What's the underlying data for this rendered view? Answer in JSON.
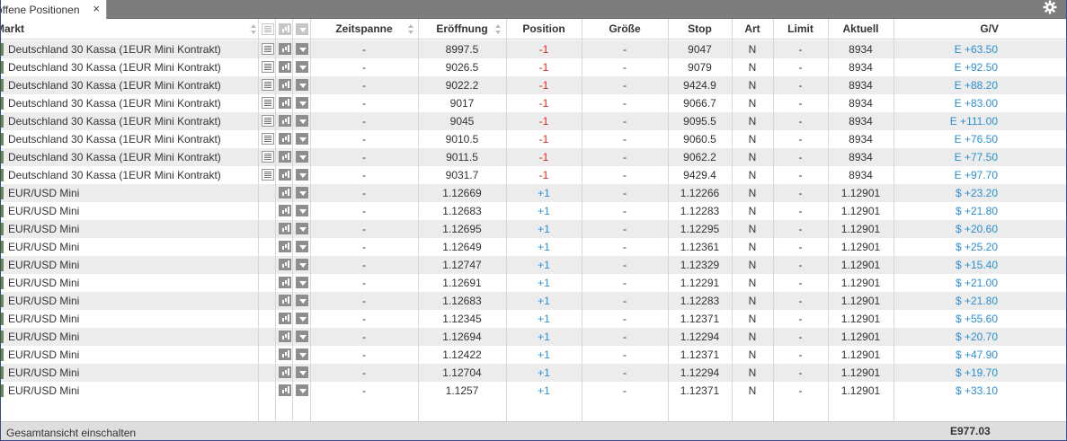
{
  "tab": {
    "label": "offene Positionen",
    "close": "×"
  },
  "header": {
    "market": "Markt",
    "zeitspanne": "Zeitspanne",
    "eroeffnung": "Eröffnung",
    "position": "Position",
    "groesse": "Größe",
    "stop": "Stop",
    "art": "Art",
    "limit": "Limit",
    "aktuell": "Aktuell",
    "gv": "G/V"
  },
  "rows": [
    {
      "market": "Deutschland 30 Kassa (1EUR Mini Kontrakt)",
      "has_doc": true,
      "zeitspanne": "-",
      "open": "8997.5",
      "position": "-1",
      "size": "-",
      "stop": "9047",
      "art": "N",
      "limit": "-",
      "current": "8934",
      "gv": "E +63.50"
    },
    {
      "market": "Deutschland 30 Kassa (1EUR Mini Kontrakt)",
      "has_doc": true,
      "zeitspanne": "-",
      "open": "9026.5",
      "position": "-1",
      "size": "-",
      "stop": "9079",
      "art": "N",
      "limit": "-",
      "current": "8934",
      "gv": "E +92.50"
    },
    {
      "market": "Deutschland 30 Kassa (1EUR Mini Kontrakt)",
      "has_doc": true,
      "zeitspanne": "-",
      "open": "9022.2",
      "position": "-1",
      "size": "-",
      "stop": "9424.9",
      "art": "N",
      "limit": "-",
      "current": "8934",
      "gv": "E +88.20"
    },
    {
      "market": "Deutschland 30 Kassa (1EUR Mini Kontrakt)",
      "has_doc": true,
      "zeitspanne": "-",
      "open": "9017",
      "position": "-1",
      "size": "-",
      "stop": "9066.7",
      "art": "N",
      "limit": "-",
      "current": "8934",
      "gv": "E +83.00"
    },
    {
      "market": "Deutschland 30 Kassa (1EUR Mini Kontrakt)",
      "has_doc": true,
      "zeitspanne": "-",
      "open": "9045",
      "position": "-1",
      "size": "-",
      "stop": "9095.5",
      "art": "N",
      "limit": "-",
      "current": "8934",
      "gv": "E +111.00"
    },
    {
      "market": "Deutschland 30 Kassa (1EUR Mini Kontrakt)",
      "has_doc": true,
      "zeitspanne": "-",
      "open": "9010.5",
      "position": "-1",
      "size": "-",
      "stop": "9060.5",
      "art": "N",
      "limit": "-",
      "current": "8934",
      "gv": "E +76.50"
    },
    {
      "market": "Deutschland 30 Kassa (1EUR Mini Kontrakt)",
      "has_doc": true,
      "zeitspanne": "-",
      "open": "9011.5",
      "position": "-1",
      "size": "-",
      "stop": "9062.2",
      "art": "N",
      "limit": "-",
      "current": "8934",
      "gv": "E +77.50"
    },
    {
      "market": "Deutschland 30 Kassa (1EUR Mini Kontrakt)",
      "has_doc": true,
      "zeitspanne": "-",
      "open": "9031.7",
      "position": "-1",
      "size": "-",
      "stop": "9429.4",
      "art": "N",
      "limit": "-",
      "current": "8934",
      "gv": "E +97.70"
    },
    {
      "market": "EUR/USD Mini",
      "has_doc": false,
      "zeitspanne": "-",
      "open": "1.12669",
      "position": "+1",
      "size": "-",
      "stop": "1.12266",
      "art": "N",
      "limit": "-",
      "current": "1.12901",
      "gv": "$ +23.20"
    },
    {
      "market": "EUR/USD Mini",
      "has_doc": false,
      "zeitspanne": "-",
      "open": "1.12683",
      "position": "+1",
      "size": "-",
      "stop": "1.12283",
      "art": "N",
      "limit": "-",
      "current": "1.12901",
      "gv": "$ +21.80"
    },
    {
      "market": "EUR/USD Mini",
      "has_doc": false,
      "zeitspanne": "-",
      "open": "1.12695",
      "position": "+1",
      "size": "-",
      "stop": "1.12295",
      "art": "N",
      "limit": "-",
      "current": "1.12901",
      "gv": "$ +20.60"
    },
    {
      "market": "EUR/USD Mini",
      "has_doc": false,
      "zeitspanne": "-",
      "open": "1.12649",
      "position": "+1",
      "size": "-",
      "stop": "1.12361",
      "art": "N",
      "limit": "-",
      "current": "1.12901",
      "gv": "$ +25.20"
    },
    {
      "market": "EUR/USD Mini",
      "has_doc": false,
      "zeitspanne": "-",
      "open": "1.12747",
      "position": "+1",
      "size": "-",
      "stop": "1.12329",
      "art": "N",
      "limit": "-",
      "current": "1.12901",
      "gv": "$ +15.40"
    },
    {
      "market": "EUR/USD Mini",
      "has_doc": false,
      "zeitspanne": "-",
      "open": "1.12691",
      "position": "+1",
      "size": "-",
      "stop": "1.12291",
      "art": "N",
      "limit": "-",
      "current": "1.12901",
      "gv": "$ +21.00"
    },
    {
      "market": "EUR/USD Mini",
      "has_doc": false,
      "zeitspanne": "-",
      "open": "1.12683",
      "position": "+1",
      "size": "-",
      "stop": "1.12283",
      "art": "N",
      "limit": "-",
      "current": "1.12901",
      "gv": "$ +21.80"
    },
    {
      "market": "EUR/USD Mini",
      "has_doc": false,
      "zeitspanne": "-",
      "open": "1.12345",
      "position": "+1",
      "size": "-",
      "stop": "1.12371",
      "art": "N",
      "limit": "-",
      "current": "1.12901",
      "gv": "$ +55.60"
    },
    {
      "market": "EUR/USD Mini",
      "has_doc": false,
      "zeitspanne": "-",
      "open": "1.12694",
      "position": "+1",
      "size": "-",
      "stop": "1.12294",
      "art": "N",
      "limit": "-",
      "current": "1.12901",
      "gv": "$ +20.70"
    },
    {
      "market": "EUR/USD Mini",
      "has_doc": false,
      "zeitspanne": "-",
      "open": "1.12422",
      "position": "+1",
      "size": "-",
      "stop": "1.12371",
      "art": "N",
      "limit": "-",
      "current": "1.12901",
      "gv": "$ +47.90"
    },
    {
      "market": "EUR/USD Mini",
      "has_doc": false,
      "zeitspanne": "-",
      "open": "1.12704",
      "position": "+1",
      "size": "-",
      "stop": "1.12294",
      "art": "N",
      "limit": "-",
      "current": "1.12901",
      "gv": "$ +19.70"
    },
    {
      "market": "EUR/USD Mini",
      "has_doc": false,
      "zeitspanne": "-",
      "open": "1.1257",
      "position": "+1",
      "size": "-",
      "stop": "1.12371",
      "art": "N",
      "limit": "-",
      "current": "1.12901",
      "gv": "$ +33.10"
    }
  ],
  "footer": {
    "link": "Gesamtansicht einschalten",
    "total": "E977.03"
  },
  "colors": {
    "negative": "#d9261c",
    "positive": "#2c8fd0",
    "tabbar": "#7d7d7d",
    "row_alt": "#ececec"
  },
  "icons": {
    "doc": "document-icon",
    "chart": "chart-icon",
    "dropdown": "dropdown-arrow-icon",
    "gear": "gear-icon",
    "close": "close-icon"
  }
}
